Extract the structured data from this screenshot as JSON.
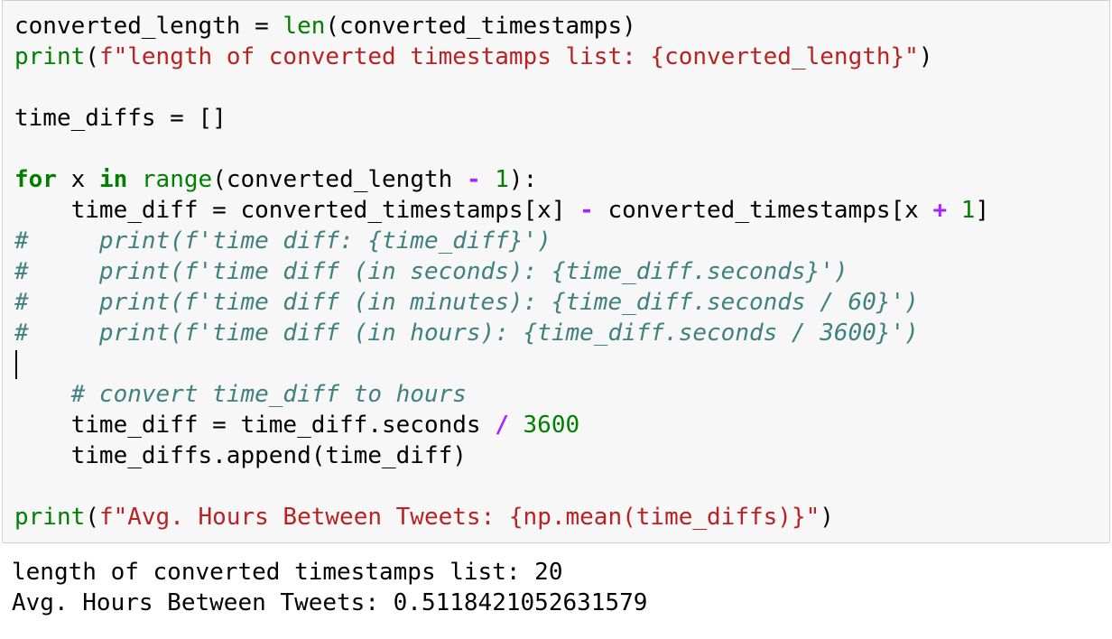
{
  "code": {
    "l1": {
      "a": "converted_length = ",
      "fn": "len",
      "b": "(converted_timestamps)"
    },
    "l2": {
      "fn": "print",
      "p1": "(",
      "s": "f\"length of converted timestamps list: {converted_length}\"",
      "p2": ")"
    },
    "l4": {
      "a": "time_diffs = []"
    },
    "l6": {
      "kw1": "for",
      "a": " x ",
      "kw2": "in",
      "sp": " ",
      "fn": "range",
      "b": "(converted_length ",
      "op": "-",
      "sp2": " ",
      "num": "1",
      "c": "):"
    },
    "l7": {
      "a": "    time_diff = converted_timestamps[x] ",
      "op1": "-",
      "b": " converted_timestamps[x ",
      "op2": "+",
      "sp": " ",
      "num": "1",
      "c": "]"
    },
    "l8": "#     print(f'time diff: {time_diff}')",
    "l9": "#     print(f'time diff (in seconds): {time_diff.seconds}')",
    "l10": "#     print(f'time diff (in minutes): {time_diff.seconds / 60}')",
    "l11": "#     print(f'time diff (in hours): {time_diff.seconds / 3600}')",
    "l13": "    # convert time_diff to hours",
    "l14": {
      "a": "    time_diff = time_diff.seconds ",
      "op": "/",
      "sp": " ",
      "num": "3600"
    },
    "l15": "    time_diffs.append(time_diff)",
    "l17": {
      "fn": "print",
      "p1": "(",
      "s": "f\"Avg. Hours Between Tweets: {np.mean(time_diffs)}\"",
      "p2": ")"
    }
  },
  "output": {
    "line1": "length of converted timestamps list: 20",
    "line2": "Avg. Hours Between Tweets: 0.5118421052631579"
  }
}
